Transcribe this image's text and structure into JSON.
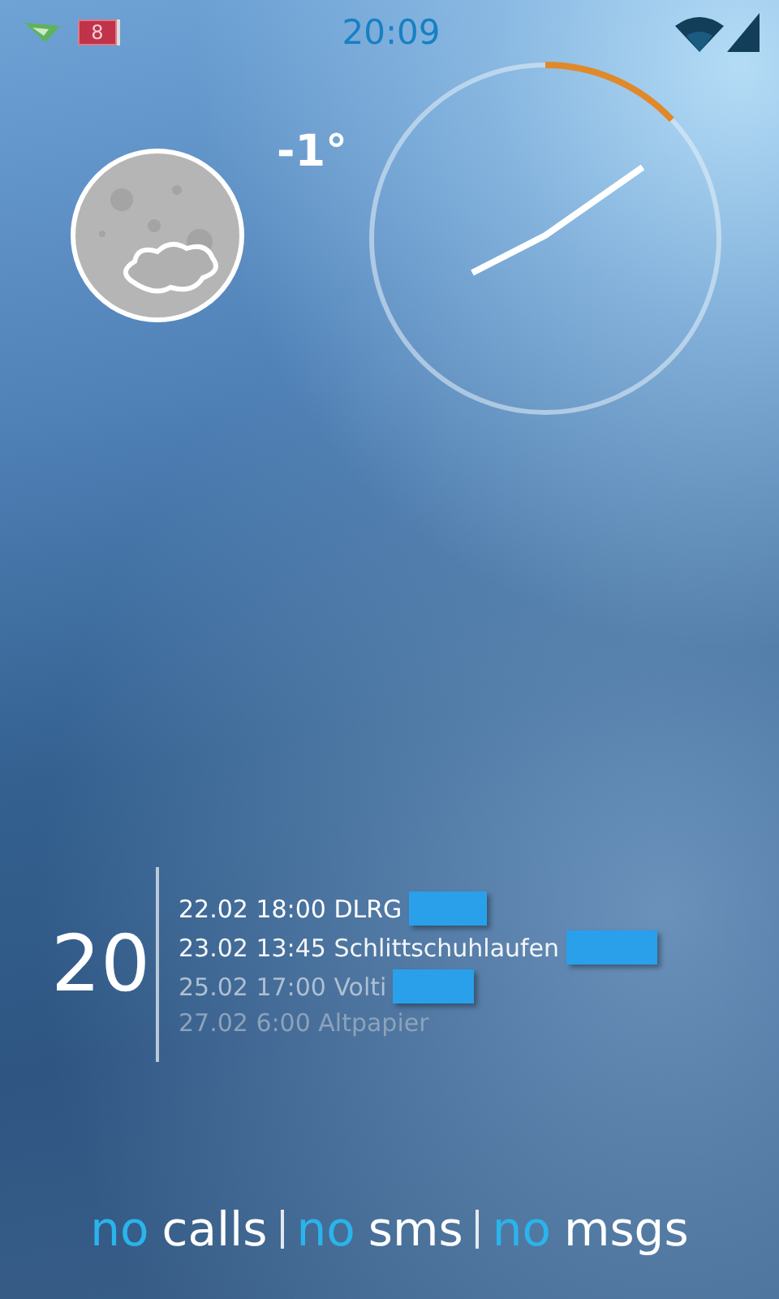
{
  "status_bar": {
    "battery": "8",
    "time": "20:09"
  },
  "weather": {
    "temperature": "-1°"
  },
  "calendar": {
    "day": "20",
    "events": [
      {
        "text": "22.02 18:00 DLRG",
        "color": "#ffffff",
        "redacted": true
      },
      {
        "text": "23.02 13:45 Schlittschuhlaufen",
        "color": "#f2f5f8",
        "redacted": true
      },
      {
        "text": "25.02 17:00 Volti",
        "color": "#aebfd2",
        "redacted": true
      },
      {
        "text": "27.02 6:00 Altpapier",
        "color": "#8da2ba",
        "redacted": false
      }
    ]
  },
  "notifications": [
    {
      "count": "no",
      "label": "calls"
    },
    {
      "count": "no",
      "label": "sms"
    },
    {
      "count": "no",
      "label": "msgs"
    }
  ]
}
